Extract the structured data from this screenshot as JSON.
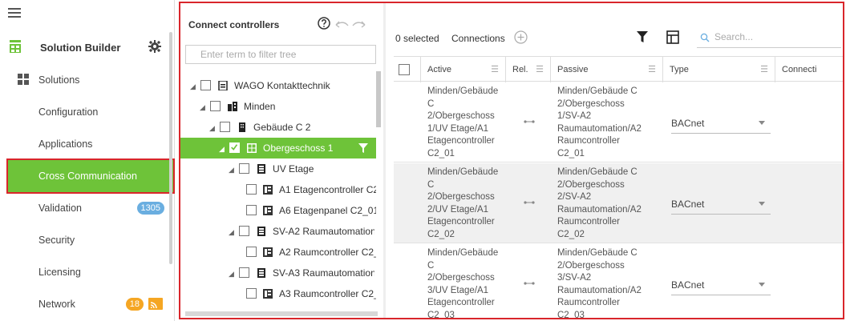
{
  "sidebar": {
    "app_title": "Solution Builder",
    "items": [
      {
        "label": "Solutions",
        "icon": "solutions-icon"
      },
      {
        "label": "Configuration"
      },
      {
        "label": "Applications"
      },
      {
        "label": "Cross Communication",
        "active": true
      },
      {
        "label": "Validation",
        "badge": "1305"
      },
      {
        "label": "Security"
      },
      {
        "label": "Licensing"
      },
      {
        "label": "Network",
        "badge": "18",
        "icon": "cast-icon"
      }
    ]
  },
  "tree": {
    "title": "Connect controllers",
    "filter_placeholder": "Enter term to filter tree",
    "nodes": [
      {
        "label": "WAGO Kontakttechnik",
        "icon": "document-icon"
      },
      {
        "label": "Minden",
        "icon": "city-icon"
      },
      {
        "label": "Gebäude C 2",
        "icon": "building-icon"
      },
      {
        "label": "Obergeschoss 1",
        "icon": "floor-icon",
        "selected": true
      },
      {
        "label": "UV Etage",
        "icon": "cabinet-icon"
      },
      {
        "label": "A1 Etagencontroller C2",
        "icon": "controller-icon"
      },
      {
        "label": "A6 Etagenpanel C2_01",
        "icon": "controller-icon"
      },
      {
        "label": "SV-A2 Raumautomation",
        "icon": "cabinet-icon"
      },
      {
        "label": "A2 Raumcontroller C2_",
        "icon": "controller-icon"
      },
      {
        "label": "SV-A3 Raumautomation",
        "icon": "cabinet-icon"
      },
      {
        "label": "A3 Raumcontroller C2_",
        "icon": "controller-icon"
      }
    ]
  },
  "connections": {
    "selected_text": "0 selected",
    "title": "Connections",
    "search_placeholder": "Search...",
    "columns": [
      "Active",
      "Rel.",
      "Passive",
      "Type",
      "Connecti"
    ],
    "rows": [
      {
        "active": "Minden/Gebäude\nC\n2/Obergeschoss\n1/UV Etage/A1\nEtagencontroller\nC2_01",
        "passive": "Minden/Gebäude C\n2/Obergeschoss\n1/SV-A2\nRaumautomation/A2\nRaumcontroller\nC2_01",
        "type": "BACnet"
      },
      {
        "active": "Minden/Gebäude\nC\n2/Obergeschoss\n2/UV Etage/A1\nEtagencontroller\nC2_02",
        "passive": "Minden/Gebäude C\n2/Obergeschoss\n2/SV-A2\nRaumautomation/A2\nRaumcontroller\nC2_02",
        "type": "BACnet"
      },
      {
        "active": "Minden/Gebäude\nC\n2/Obergeschoss\n3/UV Etage/A1\nEtagencontroller\nC2_03",
        "passive": "Minden/Gebäude C\n2/Obergeschoss\n3/SV-A2\nRaumautomation/A2\nRaumcontroller\nC2_03",
        "type": "BACnet"
      }
    ]
  },
  "colors": {
    "accent_green": "#6ec339",
    "highlight_red": "#d9262b",
    "badge_blue": "#6aaee0",
    "badge_orange": "#f5a623"
  }
}
